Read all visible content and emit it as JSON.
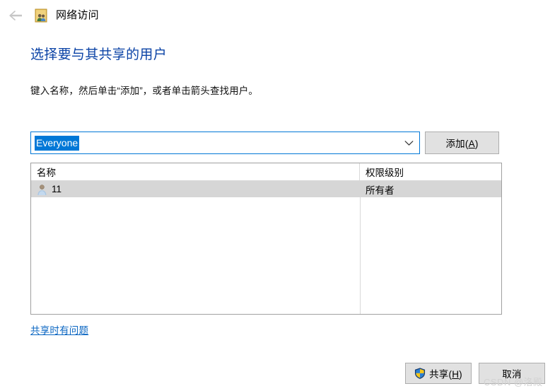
{
  "window": {
    "title": "网络访问",
    "back_icon": "back-arrow-icon",
    "title_icon": "network-share-users-icon"
  },
  "content": {
    "heading": "选择要与其共享的用户",
    "instruction": "键入名称，然后单击“添加”，或者单击箭头查找用户。"
  },
  "picker": {
    "combo_value": "Everyone",
    "combo_placeholder": "",
    "dropdown_icon": "chevron-down-icon",
    "add_button": "添加(A)",
    "add_button_text": "添加(",
    "add_button_key": "A",
    "add_button_tail": ")"
  },
  "list": {
    "columns": [
      "名称",
      "权限级别"
    ],
    "rows": [
      {
        "icon": "user-icon",
        "name": "11",
        "permission": "所有者",
        "selected": true
      }
    ]
  },
  "links": {
    "trouble_sharing": "共享时有问题"
  },
  "footer": {
    "share_text": "共享(",
    "share_key": "H",
    "share_tail": ")",
    "share_label": "共享(H)",
    "cancel_label": "取消",
    "shield_icon": "uac-shield-icon"
  },
  "watermark": "CSDN @洛殿",
  "colors": {
    "accent": "#0078d7",
    "heading": "#0b43a6",
    "link": "#0a66c2",
    "selection_row": "#d6d6d6",
    "button_face": "#e1e1e1",
    "button_border": "#adadad",
    "watermark": "#d2d2d2"
  }
}
